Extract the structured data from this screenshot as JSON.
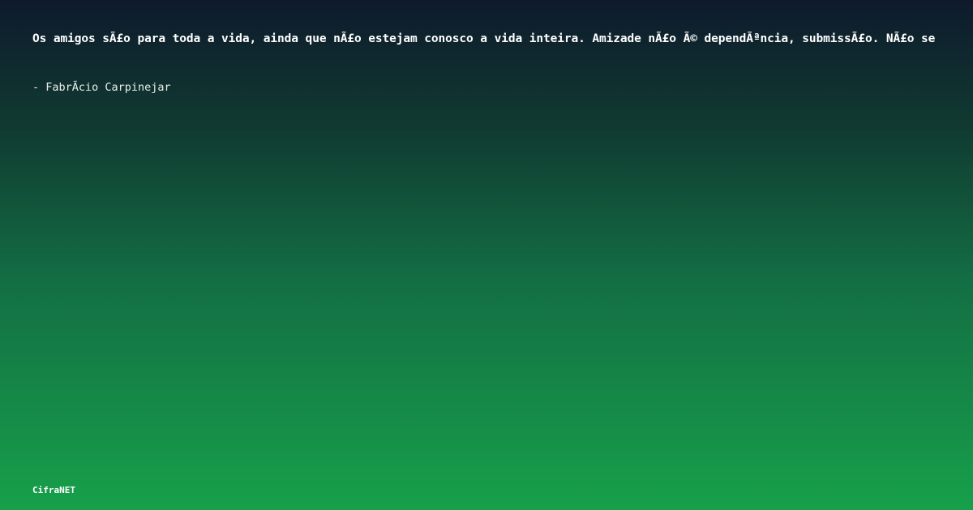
{
  "quote": {
    "text": "Os amigos sÃ£o para toda a vida, ainda que nÃ£o estejam conosco a vida inteira. Amizade nÃ£o Ã© dependÃªncia, submissÃ£o. NÃ£o se",
    "author": "- FabrÃ­cio Carpinejar"
  },
  "footer": {
    "brand": "CifraNET"
  },
  "colors": {
    "background_top": "#0e1a2c",
    "background_bottom": "#17a04a",
    "text": "#ffffff"
  }
}
